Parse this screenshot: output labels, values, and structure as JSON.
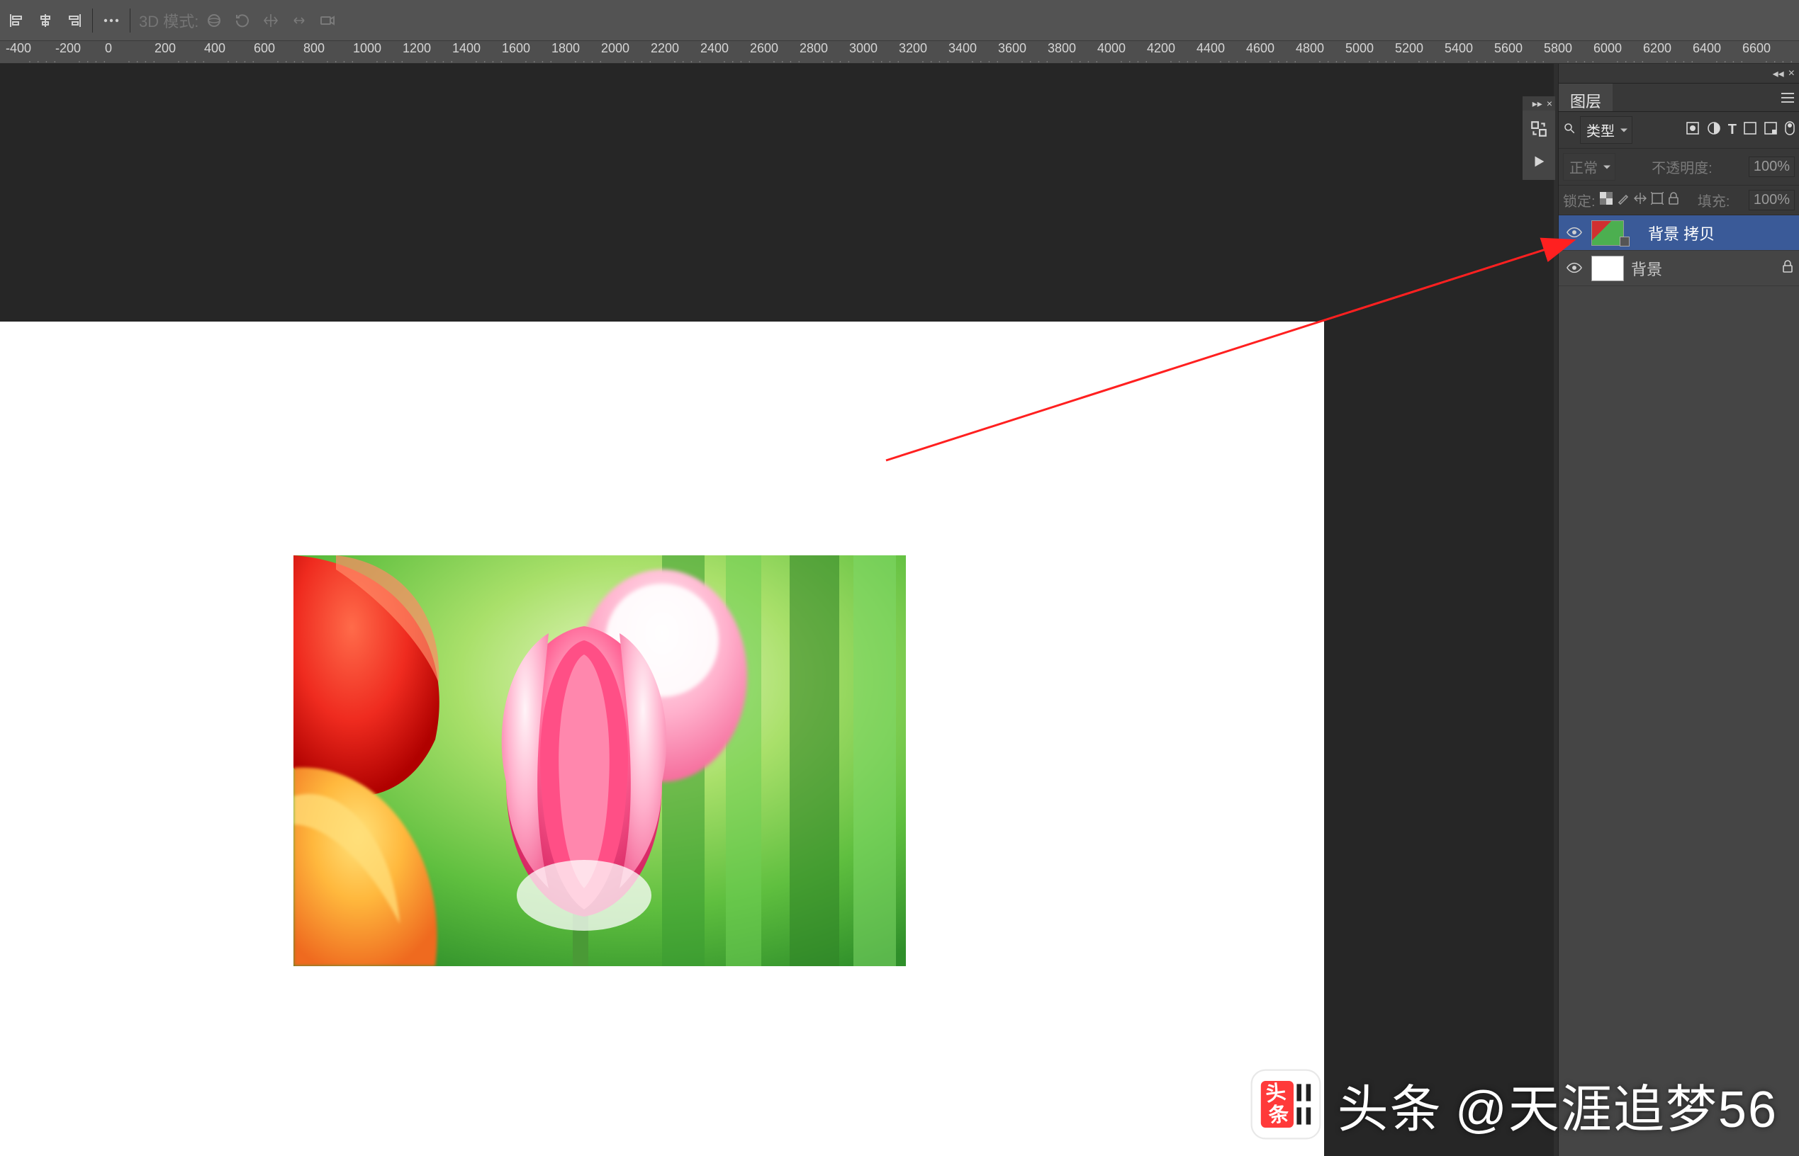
{
  "optbar": {
    "mode_label": "3D 模式:",
    "collapse_glyph": "▸▸",
    "close_glyph": "×"
  },
  "ruler": {
    "start": -400,
    "step": 200,
    "count": 36
  },
  "panel": {
    "collapse_glyph": "◂◂",
    "close_glyph": "×",
    "tab_label": "图层",
    "filter_label": "类型",
    "blend_label": "正常",
    "opacity_label": "不透明度:",
    "opacity_value": "100%",
    "lock_label": "锁定:",
    "fill_label": "填充:",
    "fill_value": "100%"
  },
  "layers": [
    {
      "name": "背景 拷贝",
      "visible": true,
      "selected": true,
      "thumb": "img",
      "locked": false
    },
    {
      "name": "背景",
      "visible": true,
      "selected": false,
      "thumb": "white",
      "locked": true
    }
  ],
  "watermark": {
    "brand": "头条",
    "handle": "@天涯追梦56"
  }
}
